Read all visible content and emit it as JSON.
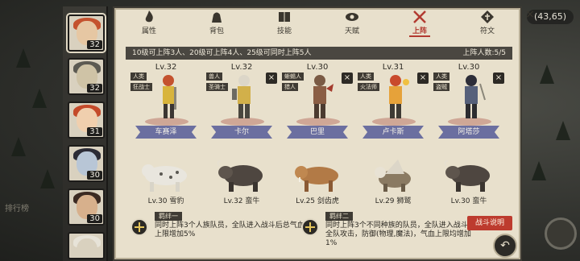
{
  "world": {
    "coords": "(43,65)",
    "side_menu_label": "排行榜"
  },
  "colors": {
    "accent_red": "#bd3b2e",
    "ribbon_purple": "#6b6fa0",
    "panel_bg": "#e8e0cc"
  },
  "portraits": [
    {
      "level": "32",
      "icon": "warrior-redhair-portrait",
      "selected": true
    },
    {
      "level": "32",
      "icon": "armored-knight-portrait"
    },
    {
      "level": "31",
      "icon": "redhair-girl-portrait"
    },
    {
      "level": "30",
      "icon": "dark-mage-portrait"
    },
    {
      "level": "30",
      "icon": "masked-rogue-portrait"
    },
    {
      "level": "",
      "icon": "hooded-figure-portrait"
    }
  ],
  "tabs": [
    {
      "label": "属性",
      "icon": "flame-icon"
    },
    {
      "label": "背包",
      "icon": "bag-icon"
    },
    {
      "label": "技能",
      "icon": "book-icon"
    },
    {
      "label": "天赋",
      "icon": "eye-icon"
    },
    {
      "label": "上阵",
      "icon": "crossed-swords-icon",
      "active": true
    },
    {
      "label": "符文",
      "icon": "rune-icon"
    }
  ],
  "info": {
    "rule_text": "10级可上阵3人、20级可上阵4人、25级可同时上阵5人",
    "count_text": "上阵人数:5/5"
  },
  "heroes": [
    {
      "lv": "Lv.32",
      "race": "人类",
      "role": "狂战士",
      "name": "车赛泽",
      "removable": false
    },
    {
      "lv": "Lv.32",
      "race": "兽人",
      "role": "圣骑士",
      "name": "卡尔",
      "removable": true
    },
    {
      "lv": "Lv.30",
      "race": "蜥蜴人",
      "role": "猎人",
      "name": "巴里",
      "removable": true
    },
    {
      "lv": "Lv.31",
      "race": "人类",
      "role": "火法师",
      "name": "卢卡斯",
      "removable": true
    },
    {
      "lv": "Lv.30",
      "race": "人类",
      "role": "盗贼",
      "name": "阿塔莎",
      "removable": true
    }
  ],
  "mounts": [
    {
      "label": "Lv.30 雪豹",
      "icon": "snow-leopard-icon"
    },
    {
      "label": "Lv.32 蛮牛",
      "icon": "wild-ox-icon"
    },
    {
      "label": "Lv.25 剑齿虎",
      "icon": "sabertooth-icon"
    },
    {
      "label": "Lv.29 狮鹫",
      "icon": "griffin-icon"
    },
    {
      "label": "Lv.30 蛮牛",
      "icon": "wild-ox-icon"
    }
  ],
  "bonds": [
    {
      "title": "羁绊一",
      "text": "同时上阵3个人族队员，全队进入战斗后总气血上限增加5%"
    },
    {
      "title": "羁绊二",
      "text": "同时上阵3个不同种族的队员，全队进入战斗后全队攻击，防御(物理,魔法)，气血上限均增加1%"
    }
  ],
  "buttons": {
    "battle_explain": "战斗说明",
    "close": "×",
    "return": "↶"
  }
}
